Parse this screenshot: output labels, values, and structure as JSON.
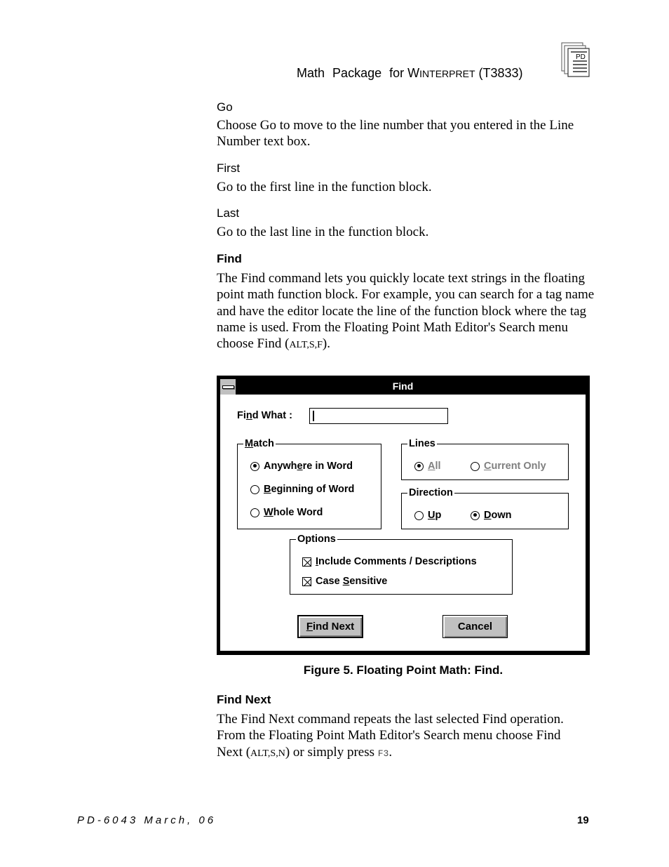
{
  "header": {
    "title_prefix": "Math",
    "title_mid": "Package",
    "title_for": "for",
    "product_initial": "W",
    "product_rest": "interpret",
    "product_code": "(T3833)",
    "logo_text": "PD"
  },
  "sections": {
    "go": {
      "heading": "Go",
      "body": "Choose Go to move to the line number that you entered in the Line Number text box."
    },
    "first": {
      "heading": "First",
      "body": "Go to the first line in the function block."
    },
    "last": {
      "heading": "Last",
      "body": "Go to the last line in the function block."
    },
    "find": {
      "heading": "Find",
      "body": "The Find command lets you quickly locate text strings in the floating point math function block.  For example, you can search for a tag name and have the editor locate the line of the function block where the tag name is used.  From the Floating Point Math Editor's Search menu choose Find",
      "shortcut_open": "(",
      "shortcut": "ALT,S,F",
      "shortcut_close": ")."
    },
    "find_next": {
      "heading": "Find Next",
      "body": "The Find Next command repeats the last selected Find operation.  From the Floating Point Math Editor's Search menu choose Find Next",
      "shortcut_open": " (",
      "shortcut": "ALT,S,N",
      "shortcut_close": ") or simply press ",
      "key": "F3",
      "end": "."
    }
  },
  "dialog": {
    "title": "Find",
    "find_what": {
      "label_pre": "Fi",
      "label_u": "n",
      "label_post": "d What :",
      "value": ""
    },
    "match": {
      "title_u": "M",
      "title_rest": "atch",
      "options": [
        {
          "pre": "Anywh",
          "u": "e",
          "post": "re in Word",
          "selected": true
        },
        {
          "pre": "",
          "u": "B",
          "post": "eginning of Word",
          "selected": false
        },
        {
          "pre": "",
          "u": "W",
          "post": "hole Word",
          "selected": false
        }
      ]
    },
    "lines": {
      "title": "Lines",
      "enabled": false,
      "options": [
        {
          "u": "A",
          "post": "ll",
          "selected": true
        },
        {
          "u": "C",
          "post": "urrent Only",
          "selected": false
        }
      ]
    },
    "direction": {
      "title": "Direction",
      "options": [
        {
          "u": "U",
          "post": "p",
          "selected": false
        },
        {
          "u": "D",
          "post": "own",
          "selected": true
        }
      ]
    },
    "options": {
      "title": "Options",
      "items": [
        {
          "u": "I",
          "post": "nclude Comments / Descriptions",
          "pre": "",
          "checked": true
        },
        {
          "pre": "Case ",
          "u": "S",
          "post": "ensitive",
          "checked": true
        }
      ]
    },
    "buttons": {
      "find_next": {
        "u": "F",
        "post": "ind Next"
      },
      "cancel": "Cancel"
    }
  },
  "figure_caption": "Figure 5.  Floating Point Math: Find.",
  "footer": {
    "doc_id": "PD-6043 March, 06",
    "page_number": "19"
  }
}
